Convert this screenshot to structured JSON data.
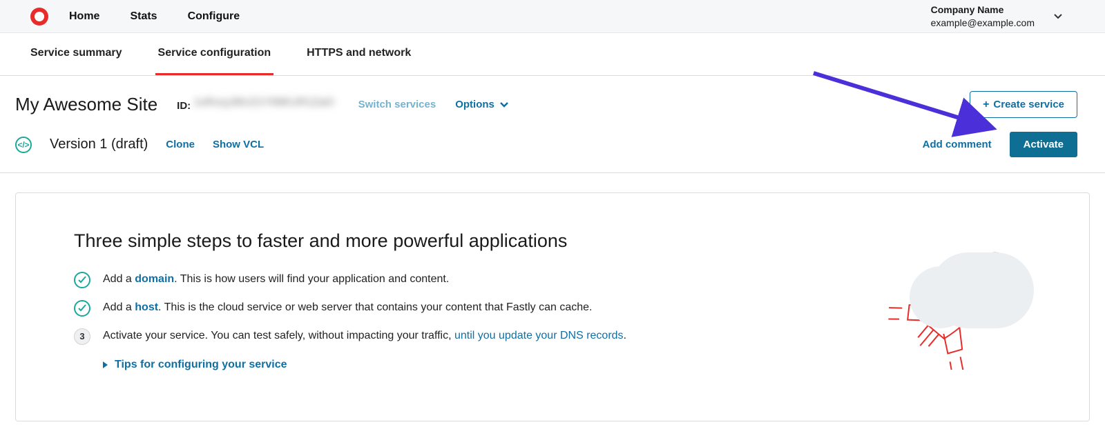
{
  "topnav": {
    "home": "Home",
    "stats": "Stats",
    "configure": "Configure"
  },
  "account": {
    "company": "Company Name",
    "email": "example@example.com"
  },
  "subtabs": {
    "summary": "Service summary",
    "config": "Service configuration",
    "https": "HTTPS and network"
  },
  "service": {
    "title": "My Awesome Site",
    "id_label": "ID:",
    "id_value": "1oRxzy36U21Y99KUR1ZaO",
    "switch": "Switch services",
    "options": "Options",
    "create": "Create service"
  },
  "version": {
    "label": "Version 1 (draft)",
    "clone": "Clone",
    "show_vcl": "Show VCL",
    "add_comment": "Add comment",
    "activate": "Activate"
  },
  "card": {
    "heading": "Three simple steps to faster and more powerful applications",
    "steps": {
      "s1_pre": "Add a ",
      "s1_link": "domain",
      "s1_post": ". This is how users will find your application and content.",
      "s2_pre": "Add a ",
      "s2_link": "host",
      "s2_post": ". This is the cloud service or web server that contains your content that Fastly can cache.",
      "s3_num": "3",
      "s3_pre": "Activate your service. You can test safely, without impacting your traffic, ",
      "s3_link": "until you update your DNS records",
      "s3_post": "."
    },
    "tips": "Tips for configuring your service"
  }
}
